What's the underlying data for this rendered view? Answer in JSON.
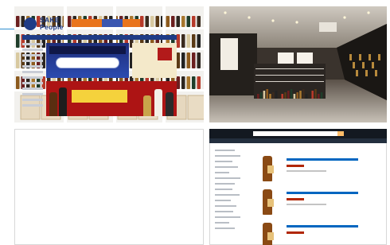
{
  "sake_site": {
    "logo_top": "SAKE",
    "logo_bottom": "People"
  },
  "colors": {
    "connector_line": "#2f8fd0",
    "sake_brand_blue": "#1f3c86",
    "sake_banner_red": "#ad1414",
    "amazon_header": "#131921",
    "amazon_subnav": "#232f3e",
    "amazon_link": "#0066c0",
    "amazon_price": "#b12704"
  }
}
